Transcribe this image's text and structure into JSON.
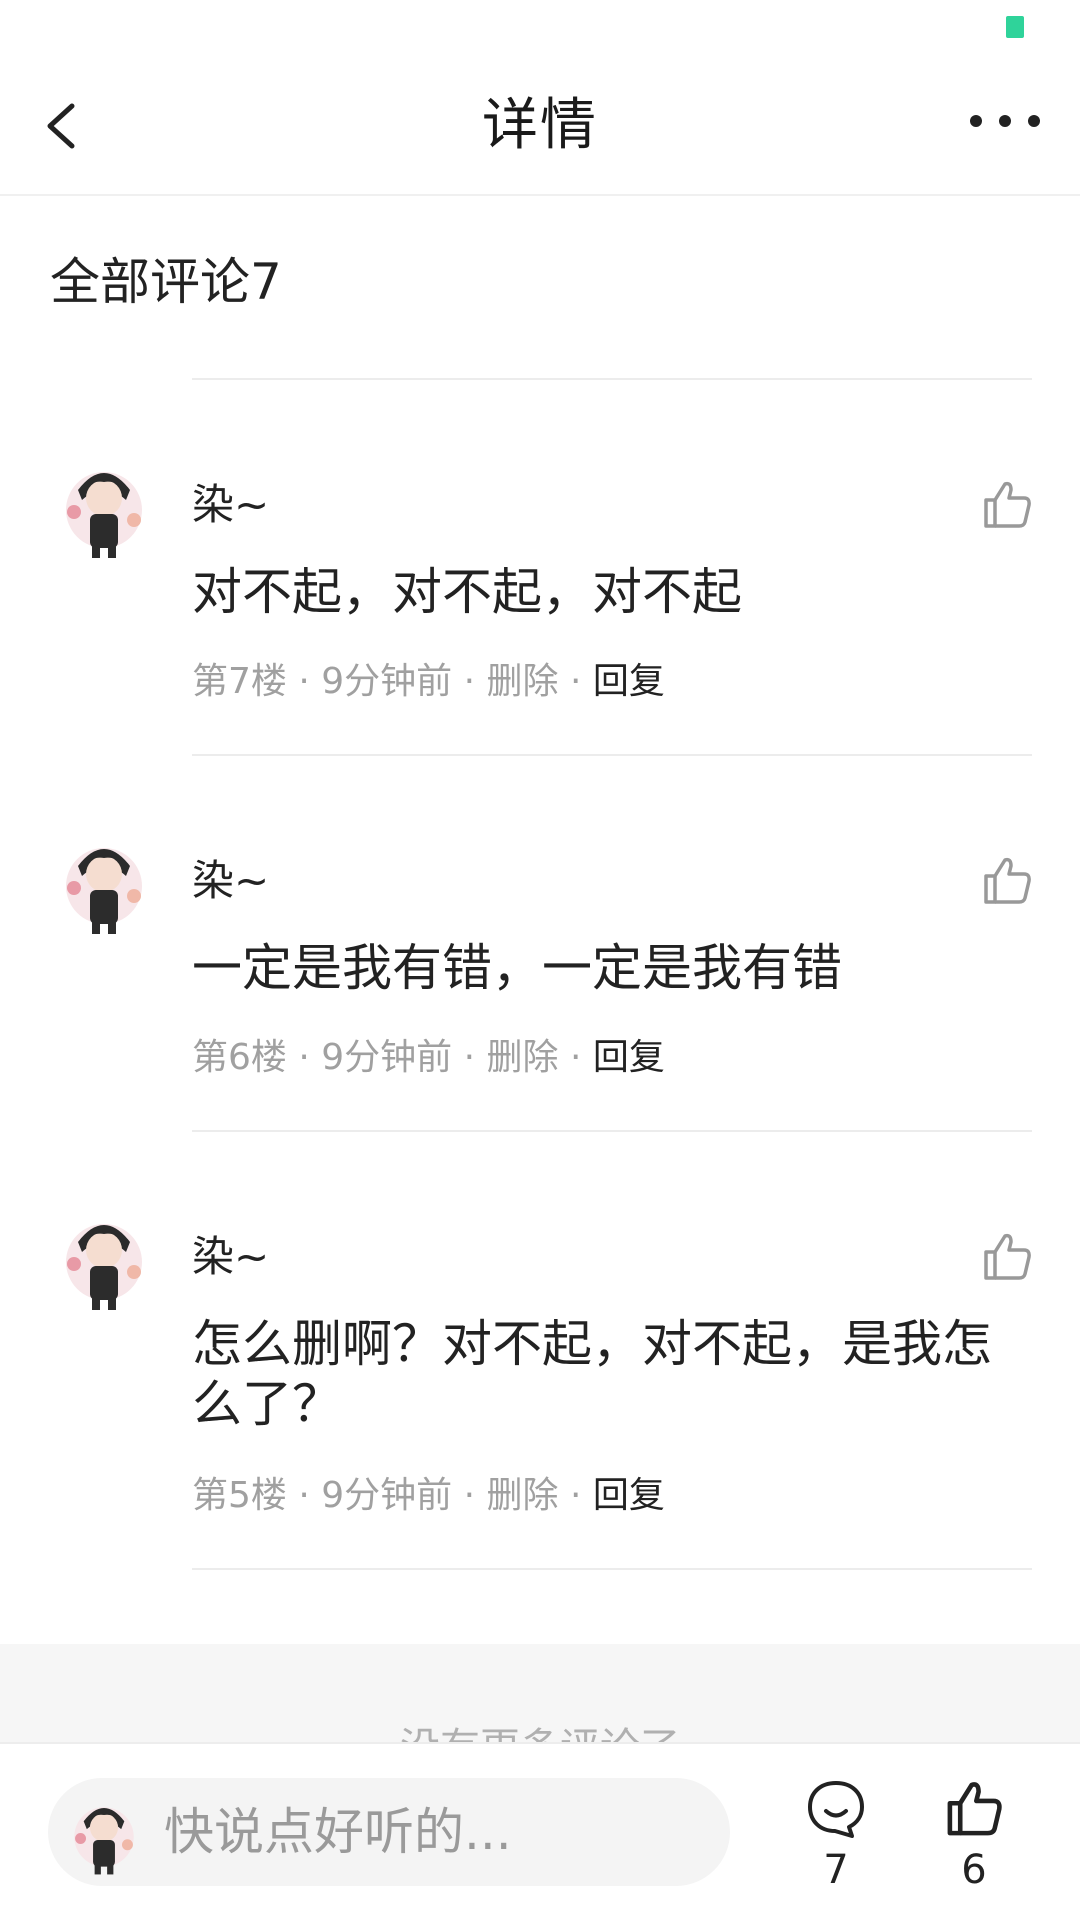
{
  "nav": {
    "title": "详情"
  },
  "section": {
    "title": "全部评论7"
  },
  "comments": [
    {
      "name": "染~",
      "text": "对不起，对不起，对不起",
      "floor": "第7楼",
      "time": "9分钟前",
      "delete": "删除",
      "reply": "回复"
    },
    {
      "name": "染~",
      "text": "一定是我有错，一定是我有错",
      "floor": "第6楼",
      "time": "9分钟前",
      "delete": "删除",
      "reply": "回复"
    },
    {
      "name": "染~",
      "text": "怎么删啊？对不起，对不起，是我怎么了？",
      "floor": "第5楼",
      "time": "9分钟前",
      "delete": "删除",
      "reply": "回复"
    }
  ],
  "footer": {
    "no_more": "没有更多评论了"
  },
  "bottom": {
    "placeholder": "快说点好听的...",
    "comment_count": "7",
    "like_count": "6"
  },
  "colors": {
    "status_dot": "#2fd39a",
    "meta_gray": "#a0a0a0",
    "text": "#222222"
  },
  "icons": {
    "back": "chevron-left-icon",
    "more": "more-dots-icon",
    "like": "thumbs-up-icon",
    "comment": "chat-bubble-icon"
  }
}
